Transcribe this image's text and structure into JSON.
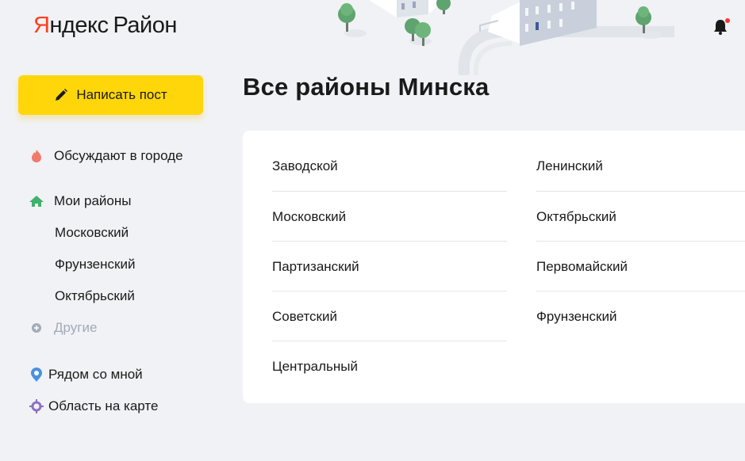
{
  "header": {
    "logo_ya": "Я",
    "logo_rest": "ндекс",
    "logo_service": "Район",
    "bell_badge_color": "#ff3333",
    "accent_color": "#ffd60a",
    "brand_color": "#fc3f1d"
  },
  "sidebar": {
    "write_post_label": "Написать пост",
    "items": [
      {
        "label": "Обсуждают в городе",
        "icon": "flame-icon"
      },
      {
        "label": "Мои районы",
        "icon": "home-icon"
      },
      {
        "label": "Московский"
      },
      {
        "label": "Фрунзенский"
      },
      {
        "label": "Октябрьский"
      },
      {
        "label": "Другие",
        "icon": "plus-circle-icon"
      },
      {
        "label": "Рядом со мной",
        "icon": "location-pin-icon"
      },
      {
        "label": "Область на карте",
        "icon": "map-area-icon"
      }
    ]
  },
  "main": {
    "title": "Все районы Минска",
    "districts_left": [
      "Заводской",
      "Московский",
      "Партизанский",
      "Советский",
      "Центральный"
    ],
    "districts_right": [
      "Ленинский",
      "Октябрьский",
      "Первомайский",
      "Фрунзенский"
    ]
  }
}
